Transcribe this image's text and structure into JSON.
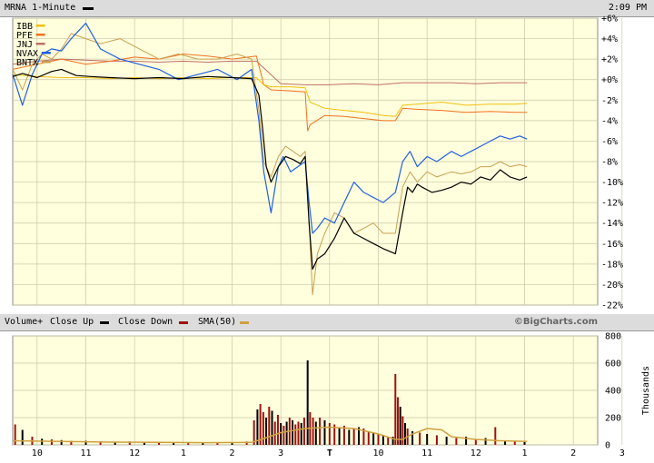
{
  "header": {
    "title": "MRNA 1-Minute",
    "time": "2:09 PM"
  },
  "volume_header": {
    "label": "Volume+",
    "close_up": "Close Up",
    "close_down": "Close Down",
    "sma": "SMA(50)",
    "brand": "©BigCharts.com"
  },
  "colors": {
    "plot_bg": "#ffffdd",
    "grid": "#c8c8a8",
    "mrna": "#000000",
    "ibb": "#f0c010",
    "pfe": "#f07020",
    "jnj": "#c07068",
    "nvax": "#2060e0",
    "bntx": "#c8a050",
    "vol_up": "#000000",
    "vol_down": "#a01010",
    "sma": "#d0a040"
  },
  "chart_data": [
    {
      "type": "line",
      "y_unit": "%",
      "ylim": [
        -22,
        6
      ],
      "y_ticks": [
        "+6%",
        "+4%",
        "+2%",
        "+0%",
        "-2%",
        "-4%",
        "-6%",
        "-8%",
        "-10%",
        "-12%",
        "-14%",
        "-16%",
        "-18%",
        "-20%",
        "-22%"
      ],
      "x_ticks": [
        "10",
        "11",
        "12",
        "1",
        "2",
        "3",
        "T",
        "10",
        "11",
        "12",
        "1",
        "2",
        "3"
      ],
      "legend": [
        {
          "name": "IBB",
          "color_key": "ibb"
        },
        {
          "name": "PFE",
          "color_key": "pfe"
        },
        {
          "name": "JNJ",
          "color_key": "jnj"
        },
        {
          "name": "NVAX",
          "color_key": "nvax"
        },
        {
          "name": "BNTX",
          "color_key": "bntx"
        }
      ],
      "series": [
        {
          "name": "MRNA",
          "color_key": "mrna",
          "width": 1.2,
          "x": [
            0,
            0.2,
            0.5,
            0.8,
            1,
            1.3,
            1.6,
            2,
            2.5,
            3,
            3.5,
            4,
            4.5,
            4.9,
            5.05,
            5.12,
            5.2,
            5.3,
            5.45,
            5.6,
            5.75,
            5.9,
            6,
            6.08,
            6.15,
            6.25,
            6.4,
            6.6,
            6.8,
            7,
            7.2,
            7.4,
            7.6,
            7.85,
            8,
            8.1,
            8.2,
            8.3,
            8.4,
            8.6,
            8.8,
            9,
            9.2,
            9.4,
            9.6,
            9.8,
            10,
            10.2,
            10.4,
            10.55
          ],
          "y": [
            0.3,
            0.6,
            0.2,
            0.8,
            1,
            0.4,
            0.3,
            0.2,
            0.1,
            0.2,
            0.1,
            0.3,
            0.2,
            0.1,
            -1.5,
            -4.5,
            -8.5,
            -10,
            -8.5,
            -7.5,
            -7.8,
            -8.2,
            -7.5,
            -14,
            -18.5,
            -17.5,
            -17,
            -15.5,
            -13.5,
            -15,
            -15.5,
            -16,
            -16.5,
            -17,
            -13,
            -10.5,
            -11,
            -10.2,
            -10.5,
            -11,
            -10.8,
            -10.5,
            -10,
            -10.2,
            -9.5,
            -9.8,
            -8.8,
            -9.5,
            -9.8,
            -9.5
          ]
        },
        {
          "name": "IBB",
          "color_key": "ibb",
          "width": 1,
          "x": [
            0,
            0.5,
            1,
            1.5,
            2,
            2.5,
            3,
            3.5,
            4,
            4.5,
            5,
            5.15,
            5.3,
            5.7,
            6,
            6.1,
            6.4,
            6.8,
            7.2,
            7.6,
            7.85,
            8,
            8.3,
            8.8,
            9.3,
            9.8,
            10.3,
            10.55
          ],
          "y": [
            0.5,
            0.3,
            0.2,
            0.2,
            0.1,
            0.2,
            0.1,
            0.2,
            0.1,
            0.2,
            0.2,
            -0.5,
            -0.7,
            -0.7,
            -0.8,
            -2.2,
            -2.8,
            -3,
            -3.2,
            -3.5,
            -3.6,
            -2.5,
            -2.4,
            -2.2,
            -2.5,
            -2.4,
            -2.4,
            -2.3
          ]
        },
        {
          "name": "PFE",
          "color_key": "pfe",
          "width": 1,
          "x": [
            0,
            0.5,
            1,
            1.5,
            2,
            2.5,
            3,
            3.5,
            4,
            4.5,
            5,
            5.15,
            5.3,
            5.7,
            6,
            6.05,
            6.1,
            6.4,
            6.8,
            7.2,
            7.6,
            7.85,
            8,
            8.3,
            8.8,
            9.3,
            9.8,
            10.3,
            10.55
          ],
          "y": [
            1,
            1.5,
            2,
            1.5,
            1.8,
            2.2,
            2,
            2.5,
            2.3,
            2,
            2.3,
            -0.5,
            -1,
            -1.1,
            -1.2,
            -5,
            -4.4,
            -3.5,
            -3.6,
            -3.8,
            -4,
            -4,
            -2.8,
            -2.9,
            -3,
            -3.2,
            -3.1,
            -3.2,
            -3.2
          ]
        },
        {
          "name": "JNJ",
          "color_key": "jnj",
          "width": 1,
          "x": [
            0,
            0.5,
            1,
            1.5,
            2,
            2.5,
            3,
            3.5,
            4,
            4.5,
            5,
            5.5,
            6,
            6.5,
            7,
            7.5,
            8,
            8.5,
            9,
            9.5,
            10,
            10.55
          ],
          "y": [
            1.5,
            1.8,
            2,
            1.9,
            1.8,
            1.8,
            1.7,
            1.8,
            1.7,
            1.8,
            1.8,
            -0.4,
            -0.5,
            -0.5,
            -0.4,
            -0.5,
            -0.3,
            -0.3,
            -0.3,
            -0.4,
            -0.3,
            -0.3
          ]
        },
        {
          "name": "NVAX",
          "color_key": "nvax",
          "width": 1.2,
          "x": [
            0,
            0.2,
            0.4,
            0.6,
            0.8,
            1,
            1.2,
            1.5,
            1.8,
            2.2,
            2.6,
            3,
            3.4,
            3.8,
            4.2,
            4.6,
            4.9,
            5.05,
            5.15,
            5.3,
            5.45,
            5.55,
            5.7,
            5.85,
            6,
            6.08,
            6.15,
            6.25,
            6.4,
            6.6,
            6.8,
            7,
            7.2,
            7.4,
            7.6,
            7.85,
            8,
            8.15,
            8.3,
            8.5,
            8.7,
            9,
            9.2,
            9.4,
            9.6,
            9.8,
            10,
            10.2,
            10.4,
            10.55
          ],
          "y": [
            0.5,
            -2.5,
            0.5,
            2.5,
            3,
            2.8,
            4,
            5.5,
            3,
            2,
            1.5,
            1,
            0,
            0.5,
            1,
            0,
            1,
            -4,
            -9,
            -13,
            -8.5,
            -7.5,
            -9,
            -8.5,
            -8,
            -12,
            -15,
            -14.5,
            -13.5,
            -14,
            -12,
            -10,
            -11,
            -11.5,
            -12,
            -11,
            -8,
            -7,
            -8.5,
            -7.5,
            -8,
            -7,
            -7.5,
            -7,
            -6.5,
            -6,
            -5.5,
            -5.8,
            -5.5,
            -5.8
          ]
        },
        {
          "name": "BNTX",
          "color_key": "bntx",
          "width": 1,
          "x": [
            0,
            0.2,
            0.4,
            0.6,
            0.8,
            1,
            1.2,
            1.5,
            1.8,
            2.2,
            2.6,
            3,
            3.4,
            3.8,
            4.2,
            4.6,
            4.9,
            5.05,
            5.15,
            5.3,
            5.45,
            5.6,
            5.75,
            5.9,
            6,
            6.08,
            6.15,
            6.25,
            6.4,
            6.6,
            6.8,
            7,
            7.2,
            7.4,
            7.6,
            7.85,
            8,
            8.15,
            8.3,
            8.5,
            8.7,
            9,
            9.2,
            9.4,
            9.6,
            9.8,
            10,
            10.2,
            10.4,
            10.55
          ],
          "y": [
            1,
            -1,
            1.5,
            2.5,
            2,
            3,
            4.5,
            4,
            3.5,
            4,
            3,
            2,
            2.5,
            2,
            2,
            2.5,
            2,
            -3,
            -8,
            -9.5,
            -7.5,
            -6.5,
            -7,
            -7.5,
            -7,
            -14,
            -21,
            -17,
            -15,
            -13,
            -13.5,
            -15,
            -14.5,
            -14,
            -15,
            -15,
            -10.5,
            -9,
            -10,
            -9,
            -9.5,
            -9,
            -9.2,
            -9,
            -8.5,
            -8.5,
            -8,
            -8.5,
            -8.3,
            -8.5
          ]
        }
      ],
      "x_range": [
        0,
        12
      ]
    },
    {
      "type": "bar",
      "ylabel": "Thousands",
      "ylim": [
        0,
        800
      ],
      "y_ticks": [
        "800",
        "600",
        "400",
        "200",
        "0"
      ],
      "legend": [
        "Close Up",
        "Close Down",
        "SMA(50)"
      ],
      "bars_x": [
        0.05,
        0.2,
        0.4,
        0.6,
        0.8,
        1,
        1.2,
        1.5,
        1.8,
        2.1,
        2.4,
        2.7,
        3,
        3.3,
        3.6,
        3.9,
        4.2,
        4.5,
        4.8,
        4.95,
        5.02,
        5.08,
        5.14,
        5.2,
        5.26,
        5.32,
        5.38,
        5.44,
        5.5,
        5.56,
        5.62,
        5.68,
        5.74,
        5.8,
        5.86,
        5.92,
        5.98,
        6.05,
        6.1,
        6.16,
        6.22,
        6.3,
        6.4,
        6.5,
        6.6,
        6.7,
        6.8,
        6.9,
        7,
        7.1,
        7.2,
        7.3,
        7.4,
        7.5,
        7.6,
        7.7,
        7.8,
        7.85,
        7.9,
        7.95,
        8,
        8.05,
        8.1,
        8.2,
        8.35,
        8.5,
        8.7,
        8.9,
        9.1,
        9.3,
        9.5,
        9.7,
        9.9,
        10.1,
        10.3,
        10.5
      ],
      "bars_v": [
        150,
        110,
        60,
        45,
        40,
        35,
        30,
        30,
        25,
        20,
        25,
        20,
        18,
        15,
        15,
        15,
        20,
        20,
        25,
        180,
        260,
        300,
        240,
        200,
        280,
        250,
        170,
        220,
        160,
        140,
        170,
        200,
        180,
        150,
        170,
        160,
        200,
        620,
        240,
        200,
        170,
        200,
        180,
        160,
        150,
        130,
        140,
        110,
        120,
        130,
        120,
        100,
        90,
        80,
        70,
        60,
        60,
        520,
        350,
        280,
        210,
        160,
        120,
        100,
        90,
        80,
        70,
        60,
        50,
        60,
        40,
        50,
        130,
        30,
        30,
        20
      ],
      "bars_down": [
        1,
        0,
        1,
        0,
        1,
        0,
        1,
        0,
        1,
        0,
        1,
        0,
        1,
        0,
        1,
        0,
        1,
        0,
        1,
        1,
        0,
        1,
        1,
        0,
        1,
        0,
        1,
        1,
        0,
        1,
        0,
        1,
        0,
        1,
        1,
        0,
        1,
        0,
        1,
        1,
        0,
        1,
        0,
        1,
        1,
        0,
        1,
        0,
        1,
        0,
        1,
        1,
        0,
        1,
        0,
        1,
        0,
        1,
        1,
        0,
        1,
        0,
        1,
        0,
        1,
        0,
        1,
        0,
        1,
        0,
        1,
        0,
        1,
        0,
        1,
        0
      ],
      "sma_x": [
        0,
        1,
        2,
        3,
        4,
        4.9,
        5.1,
        5.5,
        6,
        6.5,
        7,
        7.5,
        7.85,
        8,
        8.2,
        8.5,
        8.8,
        9,
        9.5,
        10,
        10.55
      ],
      "sma_y": [
        30,
        25,
        20,
        18,
        16,
        18,
        40,
        90,
        120,
        130,
        120,
        80,
        40,
        40,
        80,
        120,
        110,
        60,
        40,
        30,
        25
      ]
    }
  ]
}
